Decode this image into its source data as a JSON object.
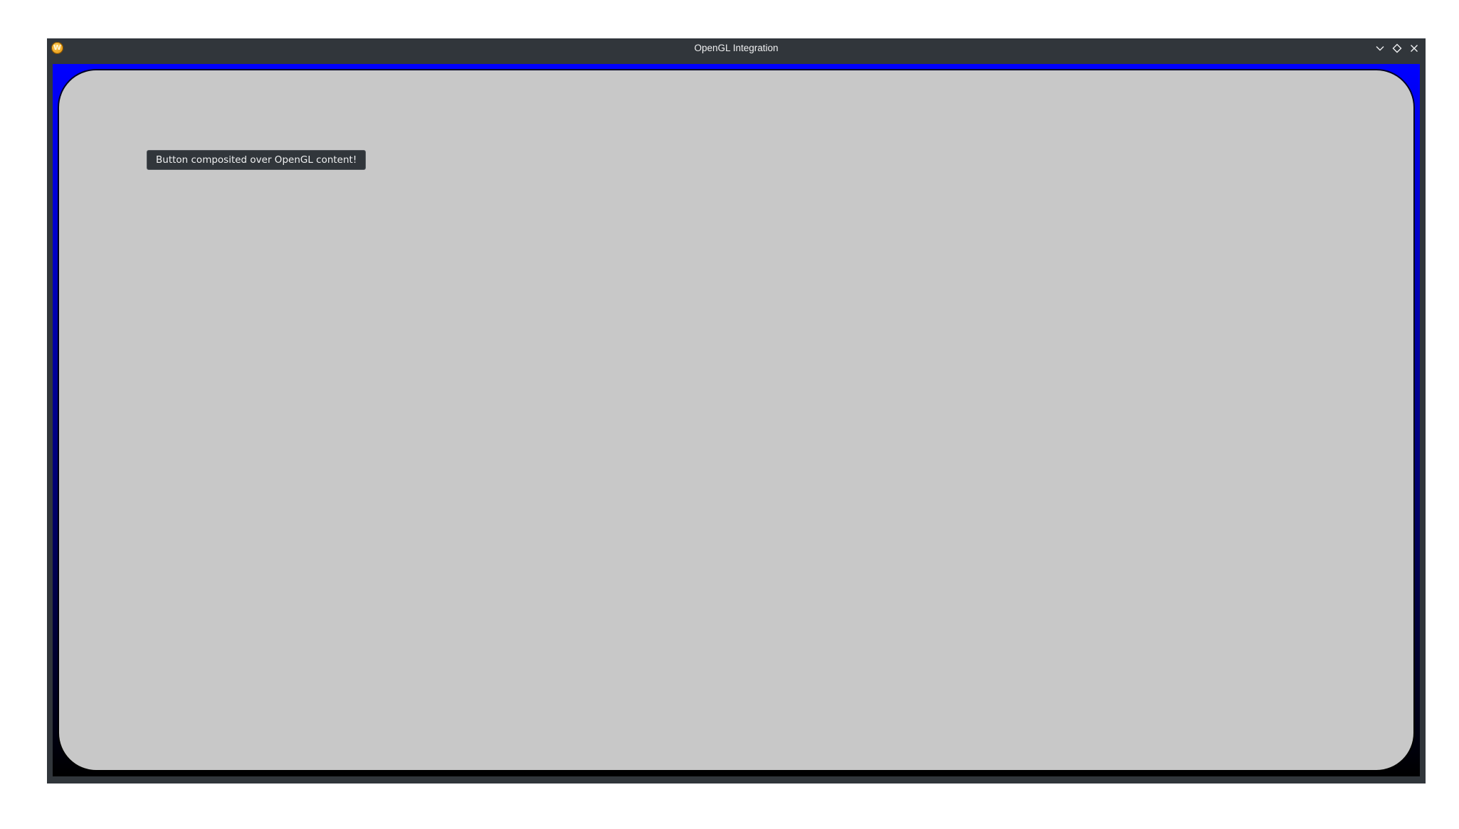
{
  "window": {
    "title": "OpenGL Integration",
    "app_icon": "app-logo-icon",
    "controls": [
      "minimize-icon",
      "maximize-icon",
      "close-icon"
    ]
  },
  "content": {
    "button_label": "Button composited over OpenGL content!"
  },
  "colors": {
    "titlebar": "#31363b",
    "title_text": "#eff0f1",
    "gl_gradient_top": "#0000ff",
    "gl_gradient_bottom": "#000000",
    "panel": "#c8c8c8",
    "button_bg": "#31363b",
    "button_text": "#eff0f1"
  }
}
